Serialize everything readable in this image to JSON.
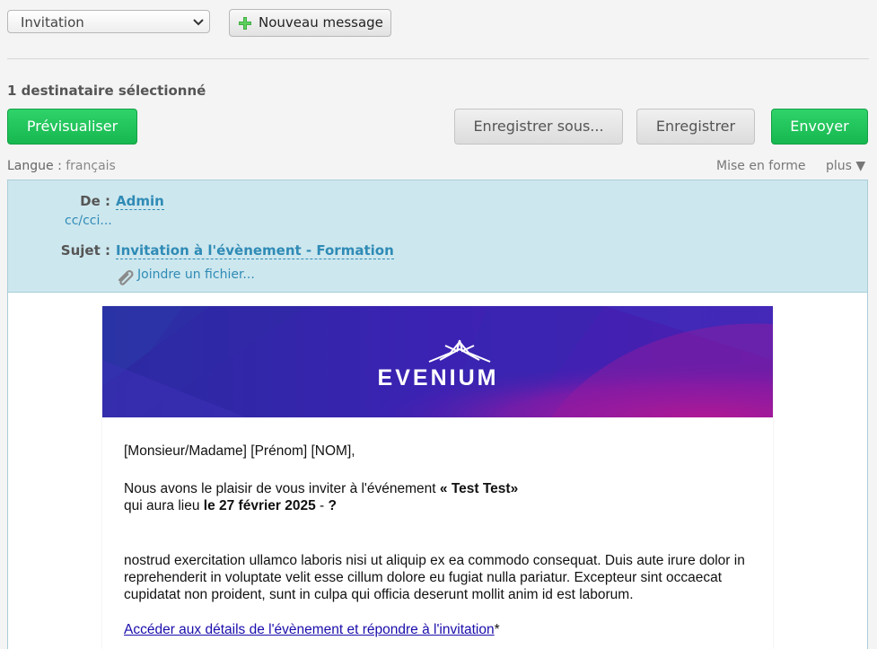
{
  "toolbar": {
    "template_select": "Invitation",
    "new_message_label": "Nouveau message"
  },
  "recipients": "1 destinataire sélectionné",
  "actions": {
    "preview": "Prévisualiser",
    "save_as": "Enregistrer sous...",
    "save": "Enregistrer",
    "send": "Envoyer"
  },
  "language": {
    "label": "Langue :",
    "value": "français"
  },
  "format": {
    "layout_label": "Mise en forme",
    "more_label": "plus ▼"
  },
  "header": {
    "from_label": "De :",
    "from_value": "Admin",
    "cc_label": "cc/cci...",
    "subject_label": "Sujet :",
    "subject_value": "Invitation à l'évènement - Formation",
    "attach_label": "Joindre un fichier..."
  },
  "email": {
    "brand": "EVENIUM",
    "greeting": "[Monsieur/Madame] [Prénom] [NOM],",
    "invite_prefix": "Nous avons le plaisir de vous inviter à l'événement ",
    "event_name": "« Test Test»",
    "date_prefix": "qui aura lieu ",
    "date_value": "le 27 février 2025",
    "date_sep": " - ",
    "date_q": "?",
    "body": "nostrud exercitation ullamco laboris nisi ut aliquip ex ea commodo consequat. Duis aute irure dolor in reprehenderit in voluptate velit esse cillum dolore eu fugiat nulla pariatur. Excepteur sint occaecat cupidatat non proident, sunt in culpa qui officia deserunt mollit anim id est laborum.",
    "link_text": "Accéder aux détails de l'évènement et répondre à l'invitation",
    "link_suffix": "*"
  },
  "colors": {
    "accent_green": "#1fbf57",
    "link_blue": "#2f8bb6",
    "header_bg": "#cde7ee",
    "banner_purple": "#3a1fa8"
  }
}
